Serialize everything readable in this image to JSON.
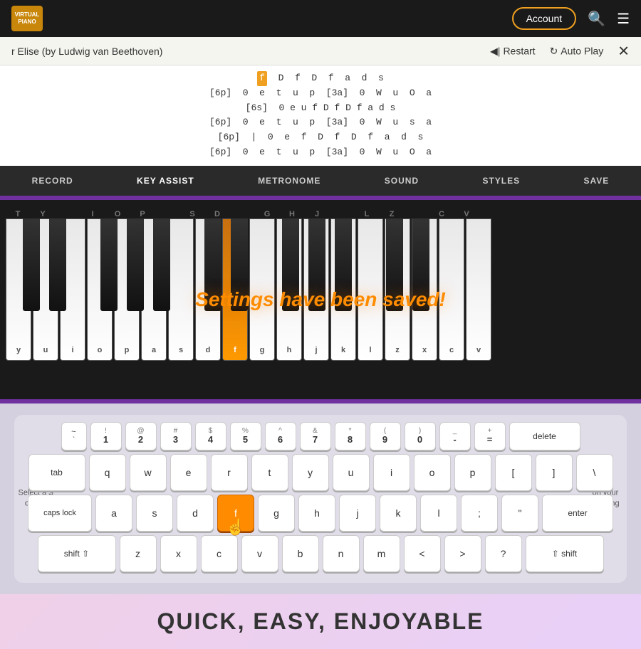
{
  "header": {
    "logo_line1": "VIRTUAL",
    "logo_line2": "PIANO",
    "account_label": "Account"
  },
  "song": {
    "title": "r Elise (by Ludwig van Beethoven)"
  },
  "controls": {
    "restart_label": "Restart",
    "autoplay_label": "Auto Play"
  },
  "sheet": {
    "lines": [
      "f  D  f  D  f  a  d  s",
      "[6p]  0  e  t  u  p  [3a]  0  W  u  O  a",
      "[6s]  0 e u f D f D f a d s",
      "[6p]  0  e  t  u  p  [3a]  0  W  u  s  a",
      "[6p]  |  0  e  f  D  f  D  f  a  d  s",
      "[6p]  0  e  t  u  p  [3a]  0  W  u  O  a"
    ],
    "highlighted_note": "f"
  },
  "toolbar": {
    "items": [
      "RECORD",
      "KEY ASSIST",
      "METRONOME",
      "SOUND",
      "STYLES",
      "SAVE"
    ]
  },
  "piano": {
    "save_message": "Settings have been saved!",
    "white_keys": [
      "T",
      "Y",
      "",
      "I",
      "O",
      "P",
      "",
      "S",
      "D",
      "",
      "G",
      "H",
      "J",
      "",
      "L",
      "Z",
      "",
      "C",
      "V"
    ],
    "bottom_labels": [
      "y",
      "u",
      "i",
      "o",
      "p",
      "a",
      "s",
      "d",
      "f",
      "g",
      "h",
      "j",
      "k",
      "l",
      "z",
      "x",
      "c",
      "v"
    ],
    "highlighted_white": "f"
  },
  "keyboard": {
    "row1": [
      {
        "top": "!",
        "bottom": "1"
      },
      {
        "top": "@",
        "bottom": "2"
      },
      {
        "top": "#",
        "bottom": "3"
      },
      {
        "top": "$",
        "bottom": "4"
      },
      {
        "top": "%",
        "bottom": "5"
      },
      {
        "top": "^",
        "bottom": "6"
      },
      {
        "top": "&",
        "bottom": "7"
      },
      {
        "top": "*",
        "bottom": "8"
      },
      {
        "top": "(",
        "bottom": "9"
      },
      {
        "top": ")",
        "bottom": "0"
      },
      {
        "top": "",
        "bottom": "-"
      },
      {
        "top": "+",
        "bottom": "="
      },
      {
        "top": "",
        "bottom": "delete"
      }
    ],
    "row2_prefix": "tab",
    "row2": [
      "q",
      "w",
      "e",
      "r",
      "t",
      "y",
      "u",
      "i",
      "o",
      "p",
      "[",
      "]",
      "\\"
    ],
    "row3_prefix": "caps lock",
    "row3": [
      "a",
      "s",
      "d",
      "f",
      "g",
      "h",
      "j",
      "k",
      "l",
      ";",
      "\"",
      "enter"
    ],
    "row4_prefix": "shift ⇧",
    "row4": [
      "z",
      "x",
      "c",
      "v",
      "b",
      "n",
      "m",
      "<",
      ">",
      "?"
    ],
    "row4_suffix": "⇧ shift",
    "highlighted_key": "f"
  },
  "side_text": {
    "left": "Select a $ or by |",
    "right": "on your he song"
  },
  "bottom": {
    "title": "QUICK, EASY, ENJOYABLE"
  }
}
